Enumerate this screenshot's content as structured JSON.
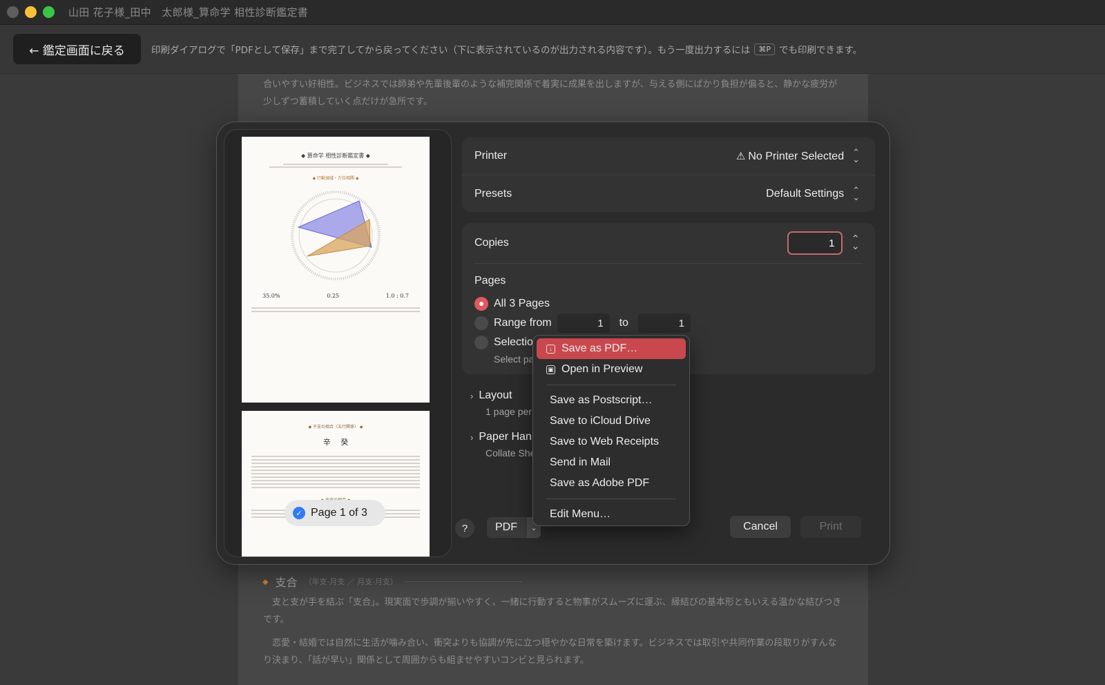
{
  "window": {
    "title": "山田 花子様_田中　太郎様_算命学 相性診断鑑定書",
    "traffic_colors": [
      "#5e5e5e",
      "#f5c13b",
      "#39c547"
    ]
  },
  "toolbar": {
    "back_label": "← 鑑定画面に戻る",
    "instruction_before": "印刷ダイアログで「PDFとして保存」まで完了してから戻ってください（下に表示されているのが出力される内容です）。もう一度出力するには",
    "shortcut": "⌘P",
    "instruction_after": "でも印刷できます。"
  },
  "document": {
    "top_paragraph": "合いやすい好相性。ビジネスでは師弟や先輩後輩のような補完関係で着実に成果を出しますが、与える側にばかり負担が偏ると、静かな疲労が少しずつ蓄積していく点だけが急所です。",
    "section_mark": "◆",
    "section_title": "支合",
    "section_subtitle": "（年支-月支 ／ 月支-月支）",
    "paragraph_1": "支と支が手を結ぶ「支合」。現実面で歩調が揃いやすく、一緒に行動すると物事がスムーズに運ぶ、縁結びの基本形ともいえる温かな結びつきです。",
    "paragraph_2": "恋愛・結婚では自然に生活が噛み合い、衝突よりも協調が先に立つ穏やかな日常を築けます。ビジネスでは取引や共同作業の段取りがすんなり決まり、「話が早い」関係として周囲からも組ませやすいコンビと見られます。"
  },
  "preview": {
    "page_badge": "Page 1 of 3",
    "page1_title": "◆ 算命学 相性診断鑑定書 ◆",
    "page1_section": "◆ 行動領域・方位相関 ◆",
    "page1_stats": [
      "35.0%",
      "0.25",
      "1.0 : 0.7"
    ],
    "page2_section": "◆ 干支の相合（五行関係） ◆",
    "page2_chars": [
      "辛",
      "癸"
    ],
    "page2_section2": "◆ 干支の相合 ◆"
  },
  "print_dialog": {
    "printer_label": "Printer",
    "printer_value": "No Printer Selected",
    "warn_icon": "⚠",
    "presets_label": "Presets",
    "presets_value": "Default Settings",
    "copies_label": "Copies",
    "copies_value": "1",
    "pages_label": "Pages",
    "all_pages_label": "All 3 Pages",
    "range_label": "Range from",
    "range_from": "1",
    "range_to_label": "to",
    "range_to": "1",
    "selection_label": "Selectio",
    "selection_sub": "Select pa",
    "layout_label": "Layout",
    "layout_sub": "1 page per s",
    "paper_label": "Paper Han",
    "paper_sub": "Collate She",
    "help_label": "?",
    "pdf_label": "PDF",
    "cancel_label": "Cancel",
    "print_label": "Print"
  },
  "pdf_menu": {
    "items_top": [
      {
        "label": "Save as PDF…",
        "icon": "download-icon"
      },
      {
        "label": "Open in Preview",
        "icon": "preview-icon"
      }
    ],
    "items_mid": [
      "Save as Postscript…",
      "Save to iCloud Drive",
      "Save to Web Receipts",
      "Send in Mail",
      "Save as Adobe PDF"
    ],
    "items_bottom": [
      "Edit Menu…"
    ],
    "highlight_color": "#c9484e"
  }
}
